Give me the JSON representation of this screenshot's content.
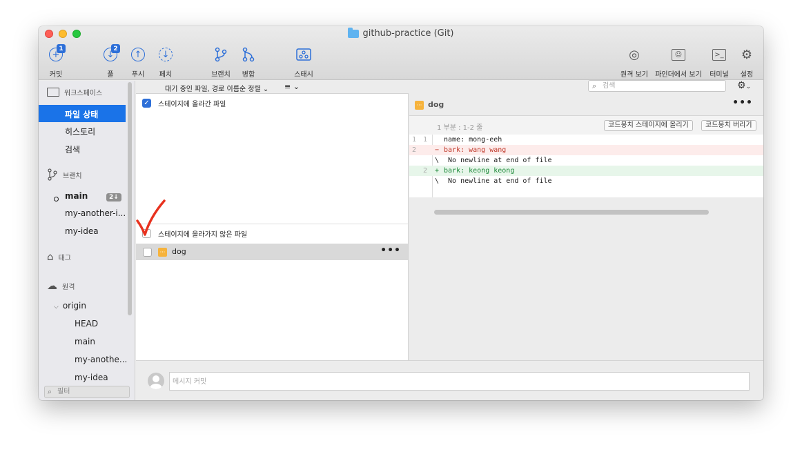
{
  "window": {
    "title": "github-practice (Git)"
  },
  "toolbar": {
    "commit": {
      "label": "커밋",
      "badge": "1"
    },
    "pull": {
      "label": "풀",
      "badge": "2"
    },
    "push": {
      "label": "푸시"
    },
    "fetch": {
      "label": "페치"
    },
    "branch": {
      "label": "브랜치"
    },
    "merge": {
      "label": "병합"
    },
    "stash": {
      "label": "스태시"
    },
    "remote_view": {
      "label": "원격 보기"
    },
    "finder_view": {
      "label": "파인더에서 보기"
    },
    "terminal": {
      "label": "터미널"
    },
    "settings": {
      "label": "설정"
    }
  },
  "sidebar": {
    "workspace": "워크스페이스",
    "workspace_items": [
      "파일 상태",
      "히스토리",
      "검색"
    ],
    "branches": "브랜치",
    "branch_items": [
      "main",
      "my-another-i...",
      "my-idea"
    ],
    "main_badge": "2↓",
    "tags": "태그",
    "remotes": "원격",
    "origin": "origin",
    "remote_items": [
      "HEAD",
      "main",
      "my-anothe...",
      "my-idea"
    ],
    "filter_placeholder": "필터"
  },
  "filebar": {
    "sort_label": "대기 중인 파일, 경로 이름순 정렬",
    "search_placeholder": "검색"
  },
  "files": {
    "staged_header": "스테이지에 올라간 파일",
    "unstaged_header": "스테이지에 올라가지 않은 파일",
    "unstaged": [
      {
        "name": "dog"
      }
    ]
  },
  "diff": {
    "file_name": "dog",
    "hunk_info": "1 부분 : 1-2 줄",
    "stage_hunk": "코드뭉치 스테이지에 올리기",
    "discard_hunk": "코드뭉치 버리기",
    "lines": [
      {
        "n1": "1",
        "n2": "1",
        "sign": "",
        "text": "name: mong-eeh",
        "type": "ctx"
      },
      {
        "n1": "2",
        "n2": "",
        "sign": "−",
        "text": "bark: wang wang",
        "type": "del"
      },
      {
        "n1": "",
        "n2": "",
        "sign": "\\",
        "text": " No newline at end of file",
        "type": "ctx"
      },
      {
        "n1": "",
        "n2": "2",
        "sign": "+",
        "text": "bark: keong keong",
        "type": "add"
      },
      {
        "n1": "",
        "n2": "",
        "sign": "\\",
        "text": " No newline at end of file",
        "type": "ctx"
      }
    ]
  },
  "commit": {
    "placeholder": "메시지 커밋"
  },
  "colors": {
    "accent": "#1a73e8",
    "annotation": "#e8321f"
  }
}
